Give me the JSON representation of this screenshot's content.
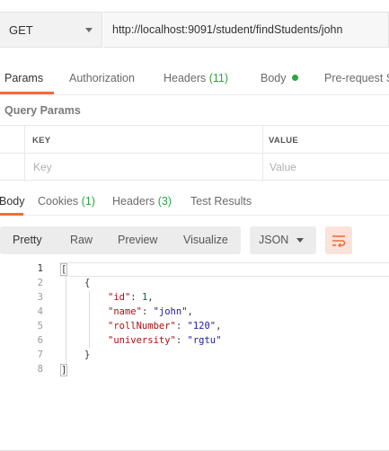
{
  "request": {
    "method": "GET",
    "url": "http://localhost:9091/student/findStudents/john"
  },
  "request_tabs": [
    {
      "label": "Params",
      "active": true
    },
    {
      "label": "Authorization"
    },
    {
      "label": "Headers",
      "count": "(11)"
    },
    {
      "label": "Body",
      "indicator": "green-dot"
    },
    {
      "label": "Pre-request S"
    }
  ],
  "query_params": {
    "title": "Query Params",
    "columns": [
      "KEY",
      "VALUE"
    ],
    "placeholders": {
      "key": "Key",
      "value": "Value"
    }
  },
  "response_tabs": [
    {
      "label": "Body",
      "active": true
    },
    {
      "label": "Cookies",
      "count": "(1)"
    },
    {
      "label": "Headers",
      "count": "(3)"
    },
    {
      "label": "Test Results"
    }
  ],
  "view_modes": [
    "Pretty",
    "Raw",
    "Preview",
    "Visualize"
  ],
  "format": "JSON",
  "wrap_icon": "wrap-lines-icon",
  "colors": {
    "accent": "#f26b3a",
    "count": "#28a745"
  },
  "code": {
    "line_numbers": [
      "1",
      "2",
      "3",
      "4",
      "5",
      "6",
      "7",
      "8"
    ],
    "open_bracket": "[",
    "open_brace": "{",
    "fields": [
      {
        "key": "\"id\"",
        "value": "1",
        "type": "number"
      },
      {
        "key": "\"name\"",
        "value": "\"john\"",
        "type": "string"
      },
      {
        "key": "\"rollNumber\"",
        "value": "\"120\"",
        "type": "string"
      },
      {
        "key": "\"university\"",
        "value": "\"rgtu\"",
        "type": "string"
      }
    ],
    "close_brace": "}",
    "close_bracket": "]"
  }
}
